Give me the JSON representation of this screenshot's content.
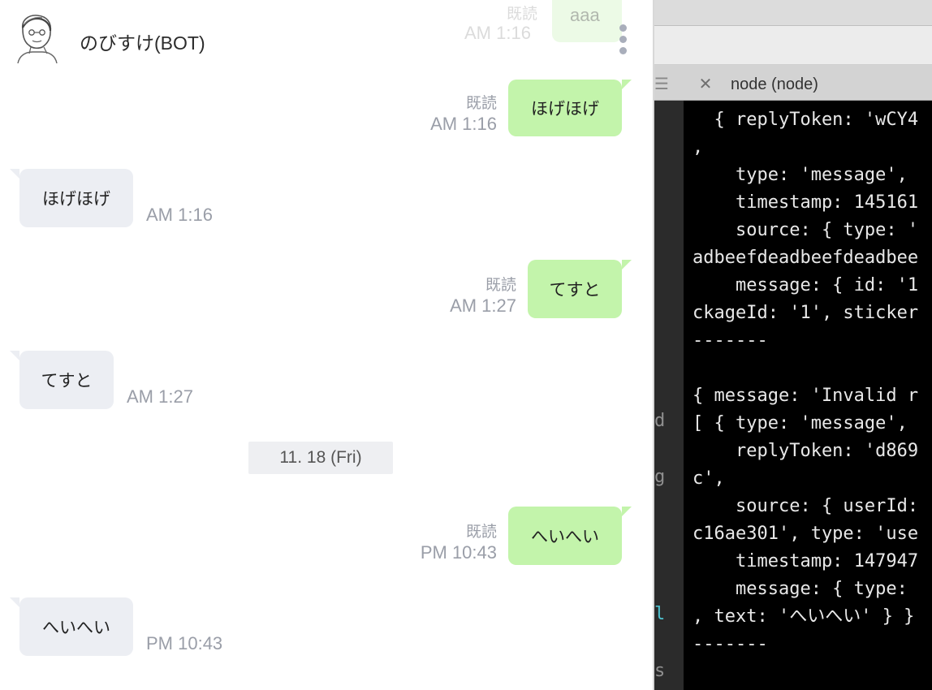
{
  "chat": {
    "title": "のびすけ(BOT)",
    "ghost": {
      "read": "既読",
      "time": "AM 1:16",
      "text": "aaa"
    },
    "messages": [
      {
        "direction": "out",
        "text": "ほげほげ",
        "read": "既読",
        "time": "AM 1:16"
      },
      {
        "direction": "in",
        "text": "ほげほげ",
        "time": "AM 1:16"
      },
      {
        "direction": "out",
        "text": "てすと",
        "read": "既読",
        "time": "AM 1:27"
      },
      {
        "direction": "in",
        "text": "てすと",
        "time": "AM 1:27"
      },
      {
        "direction": "out",
        "text": "へいへい",
        "read": "既読",
        "time": "PM 10:43"
      },
      {
        "direction": "in",
        "text": "へいへい",
        "time": "PM 10:43"
      }
    ],
    "date_separator": "11. 18 (Fri)"
  },
  "terminal": {
    "tab_title": "node (node)",
    "gutter_chars": [
      "d",
      "g",
      "l",
      "s"
    ],
    "lines": [
      "  { replyToken: 'wCY4",
      ",",
      "    type: 'message',",
      "    timestamp: 145161",
      "    source: { type: '",
      "adbeefdeadbeefdeadbee",
      "    message: { id: '1",
      "ckageId: '1', sticker",
      "-------",
      "",
      "{ message: 'Invalid r",
      "[ { type: 'message',",
      "    replyToken: 'd869",
      "c',",
      "    source: { userId:",
      "c16ae301', type: 'use",
      "    timestamp: 147947",
      "    message: { type:",
      ", text: 'へいへい' } }",
      "-------"
    ]
  },
  "colors": {
    "outgoing_bubble": "#c3f4ab",
    "incoming_bubble": "#eceef3",
    "meta_text": "#9a9ea8",
    "terminal_bg": "#000000"
  }
}
